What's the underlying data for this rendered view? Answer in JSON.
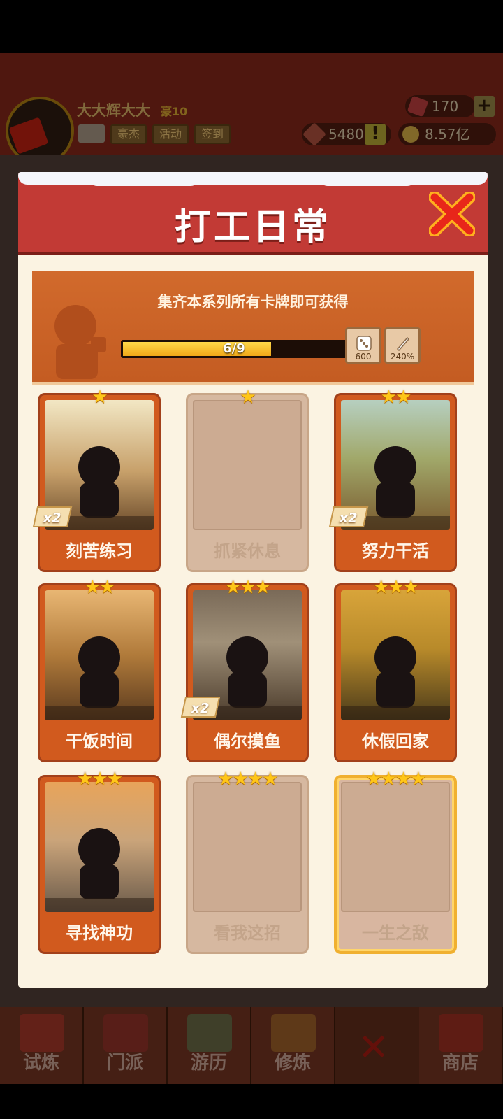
{
  "game_header": {
    "username": "大大辉大大",
    "vip_level": "豪10",
    "buttons": [
      "豪杰",
      "活动",
      "签到"
    ],
    "gems": "170",
    "tokens": "5480",
    "gold": "8.57亿"
  },
  "bottom_nav": {
    "items": [
      "试炼",
      "门派",
      "游历",
      "修炼",
      "商店"
    ]
  },
  "modal": {
    "title": "打工日常",
    "banner_text": "集齐本系列所有卡牌即可获得",
    "progress_text": "6/9",
    "progress_fraction": 0.667,
    "rewards": [
      {
        "icon": "dice-icon",
        "value": "600"
      },
      {
        "icon": "blade-icon",
        "value": "240%"
      }
    ]
  },
  "cards": [
    {
      "name": "刻苦练习",
      "stars": "★",
      "collected": true,
      "count_label": "x2",
      "art": "practice"
    },
    {
      "name": "抓紧休息",
      "stars": "★",
      "collected": false,
      "art": "empty"
    },
    {
      "name": "努力干活",
      "stars": "★★",
      "collected": true,
      "count_label": "x2",
      "art": "work"
    },
    {
      "name": "干饭时间",
      "stars": "★★",
      "collected": true,
      "art": "meal"
    },
    {
      "name": "偶尔摸鱼",
      "stars": "★★★",
      "collected": true,
      "count_label": "x2",
      "art": "slack"
    },
    {
      "name": "休假回家",
      "stars": "★★★",
      "collected": true,
      "art": "home"
    },
    {
      "name": "寻找神功",
      "stars": "★★★",
      "collected": true,
      "art": "search"
    },
    {
      "name": "看我这招",
      "stars": "★★★★",
      "collected": false,
      "art": "empty"
    },
    {
      "name": "一生之敌",
      "stars": "★★★★",
      "collected": false,
      "art": "empty",
      "rarity": "gold"
    }
  ],
  "colors": {
    "modal_header": "#c23a35",
    "card_orange": "#d15a1e",
    "star": "#ffc618",
    "progress_fill": "#f0a818"
  }
}
